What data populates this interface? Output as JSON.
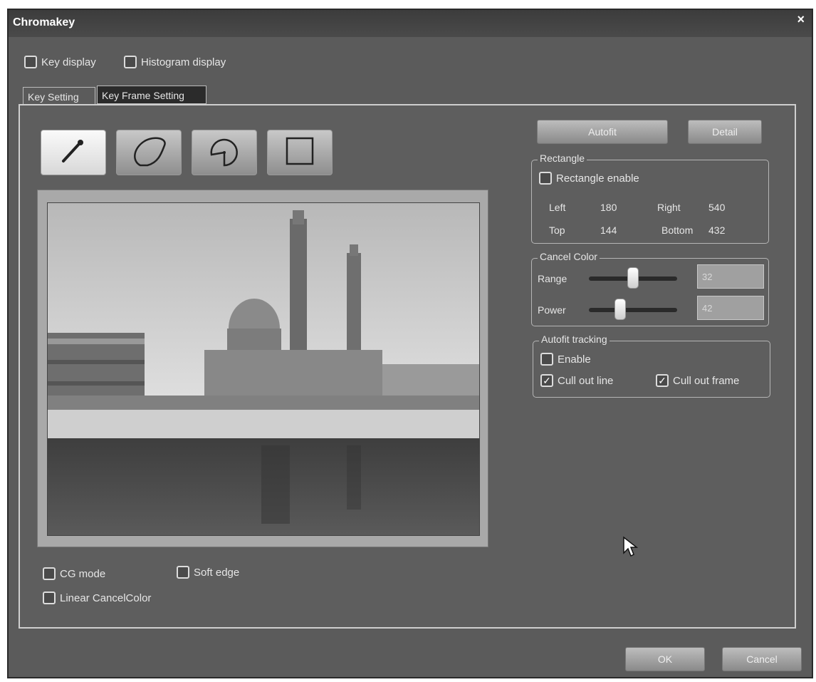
{
  "window": {
    "title": "Chromakey",
    "close_label": "×"
  },
  "display_options": {
    "key_display": "Key display",
    "histogram_display": "Histogram display"
  },
  "tabs": [
    {
      "label": "Key Setting",
      "active": true
    },
    {
      "label": "Key Frame Setting",
      "active": false
    }
  ],
  "tools": [
    {
      "name": "eyedropper-icon",
      "selected": true
    },
    {
      "name": "freehand-region-icon",
      "selected": false
    },
    {
      "name": "circle-region-icon",
      "selected": false
    },
    {
      "name": "rectangle-region-icon",
      "selected": false
    }
  ],
  "buttons": {
    "autofit": "Autofit",
    "detail": "Detail",
    "ok": "OK",
    "cancel": "Cancel"
  },
  "rectangle": {
    "title": "Rectangle",
    "enable_label": "Rectangle enable",
    "left_label": "Left",
    "left_value": "180",
    "right_label": "Right",
    "right_value": "540",
    "top_label": "Top",
    "top_value": "144",
    "bottom_label": "Bottom",
    "bottom_value": "432"
  },
  "cancel_color": {
    "title": "Cancel Color",
    "range_label": "Range",
    "range_value": "32",
    "power_label": "Power",
    "power_value": "42"
  },
  "autofit_tracking": {
    "title": "Autofit tracking",
    "enable_label": "Enable",
    "enable_checked": false,
    "cull_line_label": "Cull out line",
    "cull_line_checked": true,
    "cull_frame_label": "Cull out frame",
    "cull_frame_checked": true
  },
  "bottom_options": {
    "cg_mode": "CG mode",
    "soft_edge": "Soft edge",
    "linear_cancel_color": "Linear CancelColor"
  },
  "check_glyph": "✓"
}
